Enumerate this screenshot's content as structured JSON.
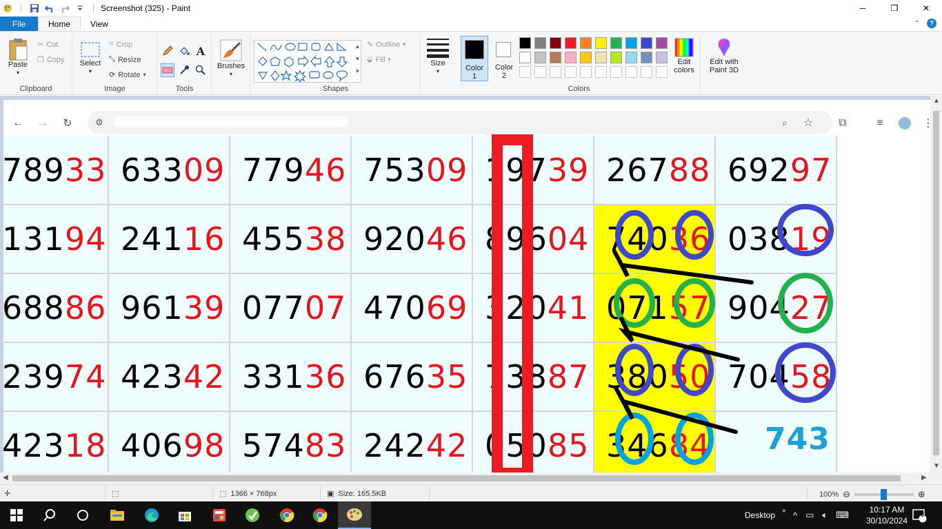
{
  "titlebar": {
    "title": "Screenshot (325) - Paint",
    "minimize": "─",
    "maximize": "❐",
    "close": "✕"
  },
  "tabs": {
    "file": "File",
    "home": "Home",
    "view": "View"
  },
  "ribbon": {
    "clipboard": {
      "paste": "Paste",
      "cut": "Cut",
      "copy": "Copy",
      "label": "Clipboard"
    },
    "image": {
      "select": "Select",
      "crop": "Crop",
      "resize": "Resize",
      "rotate": "Rotate",
      "label": "Image"
    },
    "tools": {
      "label": "Tools"
    },
    "brushes": {
      "label": "Brushes"
    },
    "shapes": {
      "outline": "Outline",
      "fill": "Fill",
      "label": "Shapes"
    },
    "size": {
      "label": "Size"
    },
    "colors": {
      "color1": "Color",
      "color1_num": "1",
      "color2": "Color",
      "color2_num": "2",
      "edit_colors": "Edit colors",
      "edit3d": "Edit with Paint 3D",
      "label": "Colors",
      "palette_row1": [
        "#000000",
        "#7f7f7f",
        "#880015",
        "#ed1c24",
        "#ff7f27",
        "#fff200",
        "#22b14c",
        "#00a2e8",
        "#3f48cc",
        "#a349a4"
      ],
      "palette_row2": [
        "#ffffff",
        "#c3c3c3",
        "#b97a57",
        "#ffaec9",
        "#ffc90e",
        "#efe4b0",
        "#b5e61d",
        "#99d9ea",
        "#7092be",
        "#c8bfe7"
      ]
    }
  },
  "table": {
    "rows": [
      [
        [
          "789",
          "33"
        ],
        [
          "633",
          "09"
        ],
        [
          "779",
          "46"
        ],
        [
          "753",
          "09"
        ],
        [
          "197",
          "39"
        ],
        [
          "267",
          "88"
        ],
        [
          "692",
          "97"
        ]
      ],
      [
        [
          "131",
          "94"
        ],
        [
          "241",
          "16"
        ],
        [
          "455",
          "38"
        ],
        [
          "920",
          "46"
        ],
        [
          "896",
          "04"
        ],
        [
          "740",
          "36"
        ],
        [
          "038",
          "19"
        ]
      ],
      [
        [
          "688",
          "86"
        ],
        [
          "961",
          "39"
        ],
        [
          "077",
          "07"
        ],
        [
          "470",
          "69"
        ],
        [
          "320",
          "41"
        ],
        [
          "071",
          "57"
        ],
        [
          "904",
          "27"
        ]
      ],
      [
        [
          "239",
          "74"
        ],
        [
          "423",
          "42"
        ],
        [
          "331",
          "36"
        ],
        [
          "676",
          "35"
        ],
        [
          "738",
          "87"
        ],
        [
          "380",
          "50"
        ],
        [
          "704",
          "58"
        ]
      ],
      [
        [
          "423",
          "18"
        ],
        [
          "406",
          "98"
        ],
        [
          "574",
          "83"
        ],
        [
          "242",
          "42"
        ],
        [
          "050",
          "85"
        ],
        [
          "346",
          "84"
        ],
        [
          "",
          ""
        ]
      ]
    ],
    "annotation": "743"
  },
  "status": {
    "dimensions": "1366 × 768px",
    "size": "Size: 165.5KB",
    "zoom": "100%"
  },
  "taskbar": {
    "desktop": "Desktop",
    "time": "10:17 AM",
    "date": "30/10/2024",
    "notifications": "6"
  }
}
